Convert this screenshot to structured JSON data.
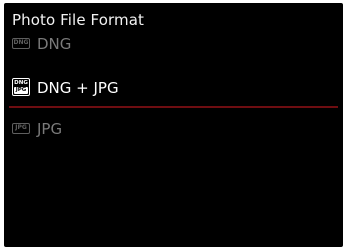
{
  "screen": {
    "title": "Photo File Format",
    "options": [
      {
        "label": "DNG",
        "icon_text": "DNG",
        "selected": false
      },
      {
        "label": "DNG + JPG",
        "icon_text_top": "DNG",
        "icon_text_bottom": "JPG",
        "selected": true
      },
      {
        "label": "JPG",
        "icon_text": "JPG",
        "selected": false
      }
    ]
  },
  "colors": {
    "background": "#000000",
    "text_active": "#ffffff",
    "text_inactive": "#7a7a7a",
    "accent_divider": "#6e0d11"
  }
}
